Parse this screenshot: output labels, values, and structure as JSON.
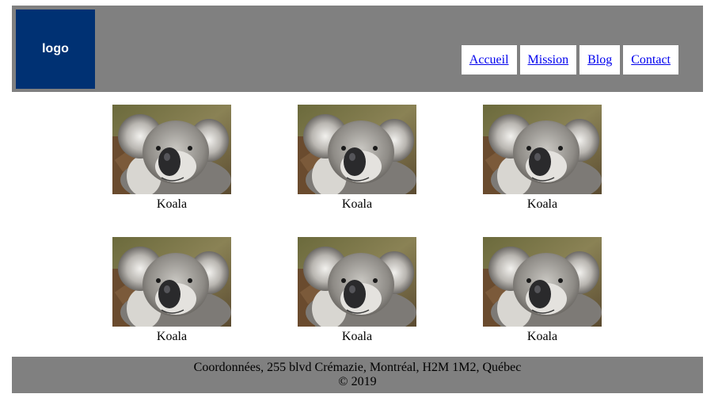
{
  "header": {
    "logo_text": "logo",
    "nav": [
      {
        "label": "Accueil"
      },
      {
        "label": "Mission"
      },
      {
        "label": "Blog"
      },
      {
        "label": "Contact"
      }
    ]
  },
  "gallery": {
    "items": [
      {
        "caption": "Koala",
        "image": "koala-photo"
      },
      {
        "caption": "Koala",
        "image": "koala-photo"
      },
      {
        "caption": "Koala",
        "image": "koala-photo"
      },
      {
        "caption": "Koala",
        "image": "koala-photo"
      },
      {
        "caption": "Koala",
        "image": "koala-photo"
      },
      {
        "caption": "Koala",
        "image": "koala-photo"
      }
    ]
  },
  "footer": {
    "address": "Coordonnées, 255 blvd Crémazie, Montréal, H2M 1M2, Québec",
    "copyright": "© 2019"
  },
  "colors": {
    "header_bg": "#808080",
    "logo_bg": "#003173",
    "link": "#0000ee",
    "footer_bg": "#808080"
  }
}
